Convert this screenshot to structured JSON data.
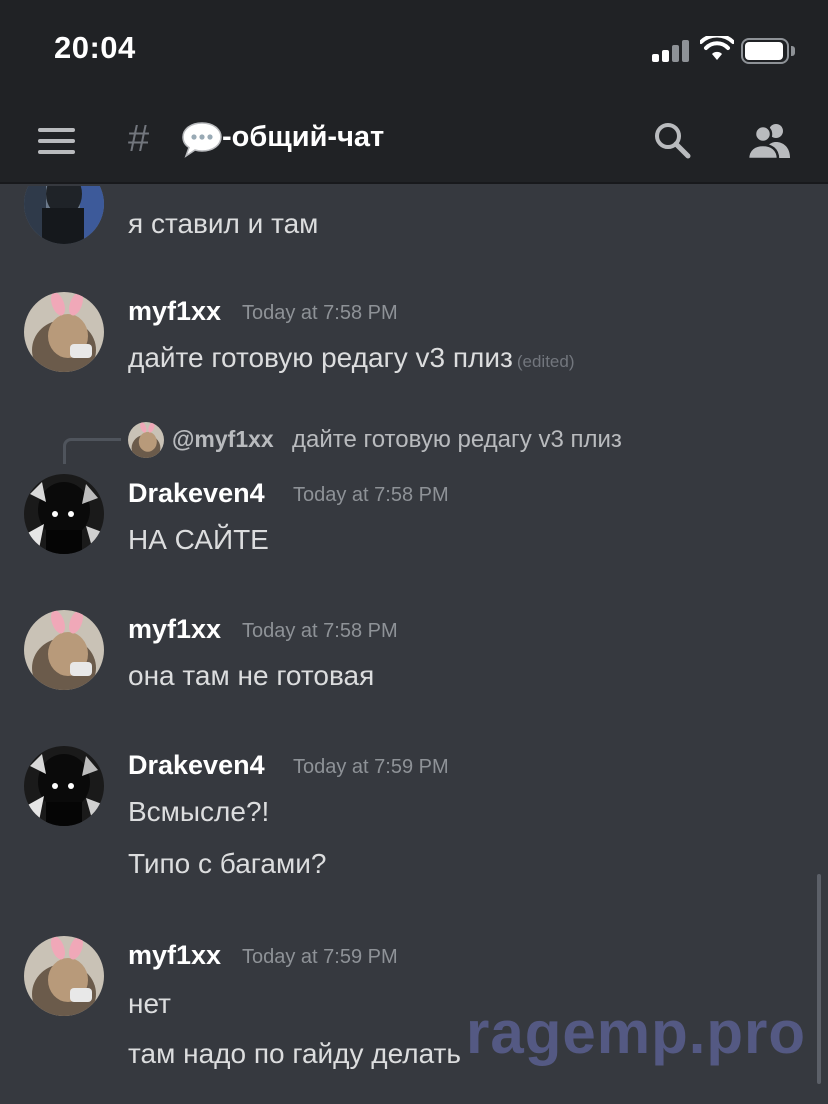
{
  "status_bar": {
    "time": "20:04"
  },
  "header": {
    "channel_name": "-общий-чат"
  },
  "top_partial": {
    "message": "я ставил и там"
  },
  "reply": {
    "mention": "@myf1xx",
    "text": "дайте готовую редагу v3 плиз"
  },
  "messages": [
    {
      "author": "myf1xx",
      "timestamp": "Today at 7:58 PM",
      "lines": [
        "дайте готовую редагу v3 плиз"
      ],
      "edited": "(edited)"
    },
    {
      "author": "Drakeven4",
      "timestamp": "Today at 7:58 PM",
      "lines": [
        "НА САЙТЕ"
      ]
    },
    {
      "author": "myf1xx",
      "timestamp": "Today at 7:58 PM",
      "lines": [
        "она там не готовая"
      ]
    },
    {
      "author": "Drakeven4",
      "timestamp": "Today at 7:59 PM",
      "lines": [
        "Всмысле?!",
        "Типо с багами?"
      ]
    },
    {
      "author": "myf1xx",
      "timestamp": "Today at 7:59 PM",
      "lines": [
        "нет",
        "там надо по гайду делать"
      ]
    }
  ],
  "watermark": "ragemp.pro"
}
